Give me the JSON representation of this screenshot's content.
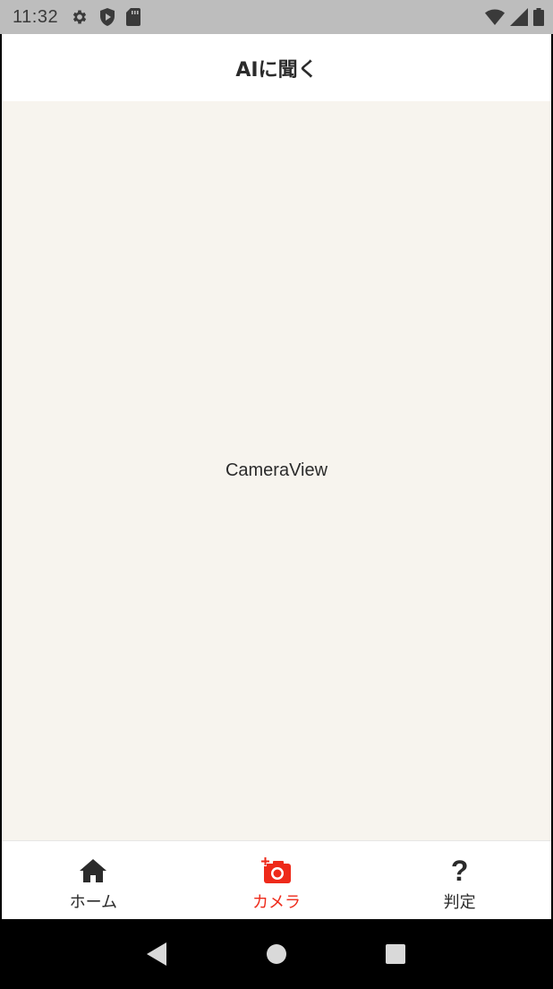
{
  "status_bar": {
    "time": "11:32",
    "left_icons": [
      "settings-icon",
      "shield-play-icon",
      "sd-card-icon"
    ],
    "right_icons": [
      "wifi-icon",
      "cell-signal-icon",
      "battery-icon"
    ]
  },
  "header": {
    "title": "AIに聞く"
  },
  "content": {
    "label": "CameraView"
  },
  "tabbar": {
    "active_color": "#ee2a1a",
    "tabs": [
      {
        "icon": "home-icon",
        "label": "ホーム",
        "active": false
      },
      {
        "icon": "add-photo-icon",
        "label": "カメラ",
        "active": true
      },
      {
        "icon": "question-icon",
        "label": "判定",
        "active": false,
        "glyph": "?"
      }
    ]
  },
  "navbar": {
    "buttons": [
      "back-icon",
      "home-circle-icon",
      "recents-square-icon"
    ]
  }
}
